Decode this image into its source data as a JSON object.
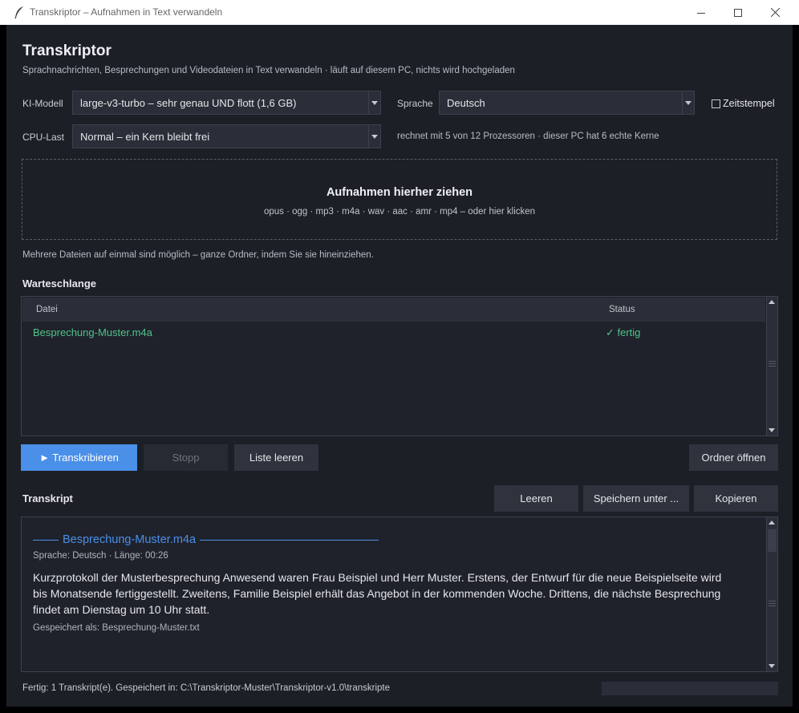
{
  "window": {
    "title": "Transkriptor  –  Aufnahmen in Text verwandeln"
  },
  "header": {
    "title": "Transkriptor",
    "subtitle": "Sprachnachrichten, Besprechungen und Videodateien in Text verwandeln  ·  läuft auf diesem PC, nichts wird hochgeladen"
  },
  "settings": {
    "model_label": "KI-Modell",
    "model_value": "large-v3-turbo  –  sehr genau UND flott  (1,6 GB)",
    "language_label": "Sprache",
    "language_value": "Deutsch",
    "timestamps_label": "Zeitstempel",
    "timestamps_checked": false,
    "cpu_label": "CPU-Last",
    "cpu_value": "Normal  –  ein Kern bleibt frei",
    "cpu_info": "rechnet mit 5 von 12 Prozessoren  ·  dieser PC hat 6 echte Kerne"
  },
  "dropzone": {
    "title": "Aufnahmen hierher ziehen",
    "formats": "opus  ·  ogg  ·  mp3  ·  m4a  ·  wav  ·  aac  ·  amr  ·  mp4     –  oder hier klicken"
  },
  "hint": "Mehrere Dateien auf einmal sind möglich – ganze Ordner, indem Sie sie hineinziehen.",
  "queue": {
    "title": "Warteschlange",
    "columns": [
      "Datei",
      "Status"
    ],
    "rows": [
      {
        "file": "Besprechung-Muster.m4a",
        "status": "✓  fertig"
      }
    ]
  },
  "actions": {
    "transcribe": "►  Transkribieren",
    "stop": "Stopp",
    "clear_list": "Liste leeren",
    "open_folder": "Ordner öffnen"
  },
  "transcript": {
    "title": "Transkript",
    "clear": "Leeren",
    "save_as": "Speichern unter ...",
    "copy": "Kopieren",
    "file_heading": "Besprechung-Muster.m4a",
    "meta": "Sprache: Deutsch    ·    Länge: 00:26",
    "body": "Kurzprotokoll der Musterbesprechung Anwesend waren Frau Beispiel und Herr Muster. Erstens, der Entwurf für die neue Beispielseite wird bis Monatsende fertiggestellt. Zweitens, Familie Beispiel erhält das Angebot in der kommenden Woche. Drittens, die nächste Besprechung findet am Dienstag um 10 Uhr statt.",
    "saved": "Gespeichert als: Besprechung-Muster.txt"
  },
  "status": {
    "text": "Fertig: 1 Transkript(e).  Gespeichert in: C:\\Transkriptor-Muster\\Transkriptor-v1.0\\transkripte",
    "progress": 0
  },
  "colors": {
    "background": "#1c1f26",
    "accent": "#4a8fe8",
    "success": "#4ec48a"
  }
}
